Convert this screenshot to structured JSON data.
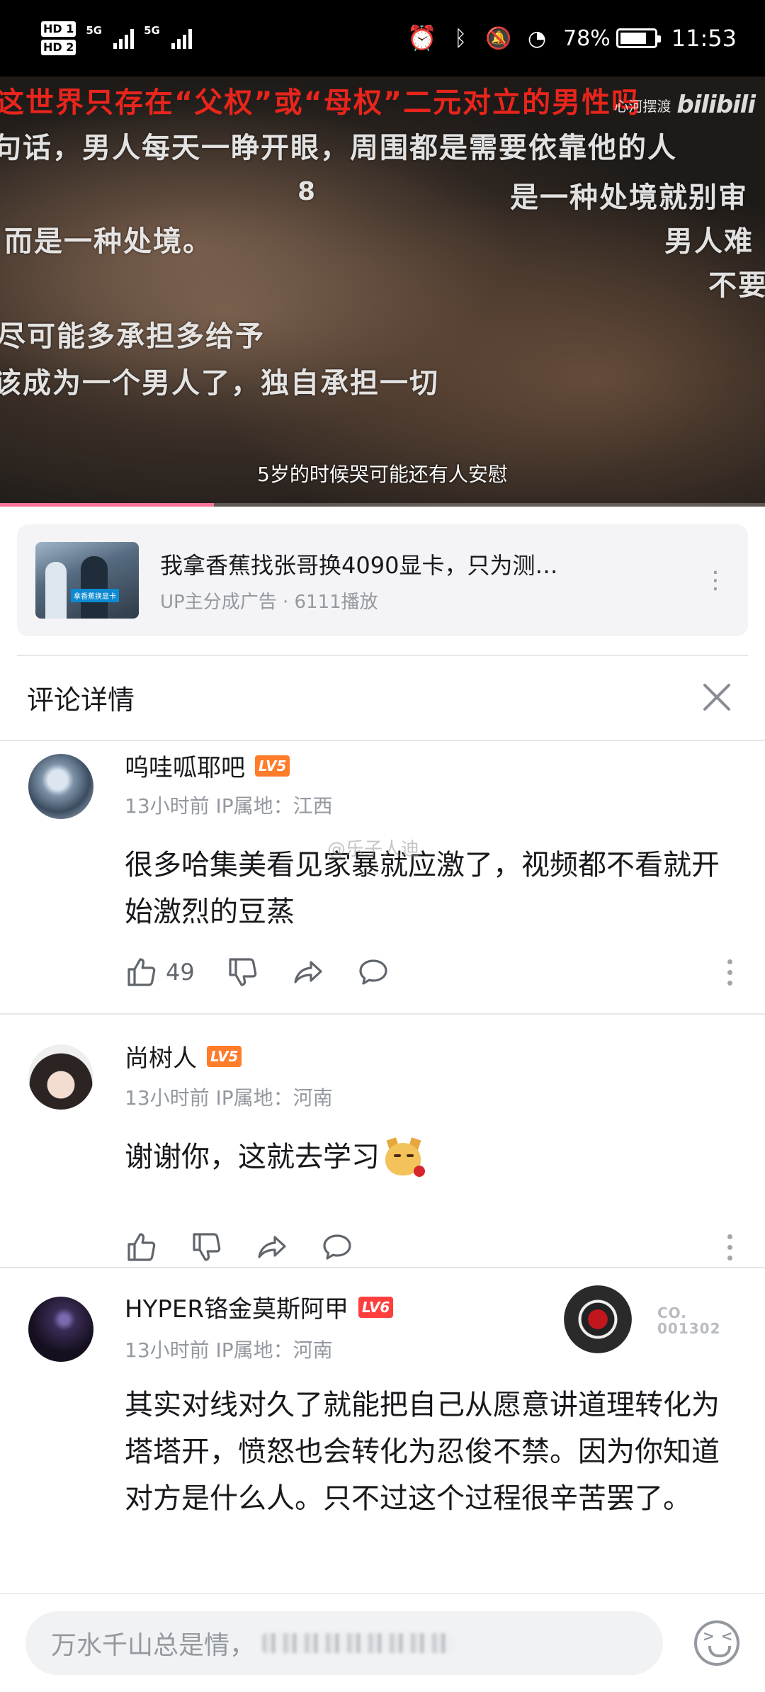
{
  "status_bar": {
    "hd1": "HD 1",
    "hd2": "HD 2",
    "net1": "5G",
    "net2": "5G",
    "battery": "78%",
    "time": "11:53"
  },
  "video": {
    "danmaku": [
      "这世界只存在“父权”或“母权”二元对立的男性吗",
      "句话，男人每天一睁开眼，周围都是需要依靠他的人",
      "8",
      "是一种处境就别审",
      "而是一种处境。",
      "男人难",
      "不要",
      "尽可能多承担多给予",
      "该成为一个男人了，独自承担一切"
    ],
    "uploader_mark": "心河摆渡",
    "site_mark": "bilibili",
    "subtitle": "5岁的时候哭可能还有人安慰",
    "progress": 0.28
  },
  "ad": {
    "thumb_tag": "拿香蕉换显卡",
    "title": "我拿香蕉找张哥换4090显卡，只为测…",
    "meta": "UP主分成广告 · 6111播放"
  },
  "comments_header": {
    "title": "评论详情"
  },
  "watermark": "@乐子人迪",
  "comments": [
    {
      "username": "呜哇呱耶吧",
      "level": "LV5",
      "meta": "13小时前 IP属地：江西",
      "text": "很多哈集美看见家暴就应激了，视频都不看就开始激烈的豆蒸",
      "likes": "49"
    },
    {
      "username": "尚树人",
      "level": "LV5",
      "meta": "13小时前 IP属地：河南",
      "text": "谢谢你，这就去学习",
      "likes": ""
    },
    {
      "username": "HYPER铬金莫斯阿甲",
      "level": "LV6",
      "meta": "13小时前 IP属地：河南",
      "text": "其实对线对久了就能把自己从愿意讲道理转化为塔塔开，愤怒也会转化为忍俊不禁。因为你知道对方是什么人。只不过这个过程很辛苦罢了。",
      "badge_label": "CO.",
      "badge_number": "001302"
    }
  ],
  "input": {
    "placeholder": "万水千山总是情，"
  }
}
